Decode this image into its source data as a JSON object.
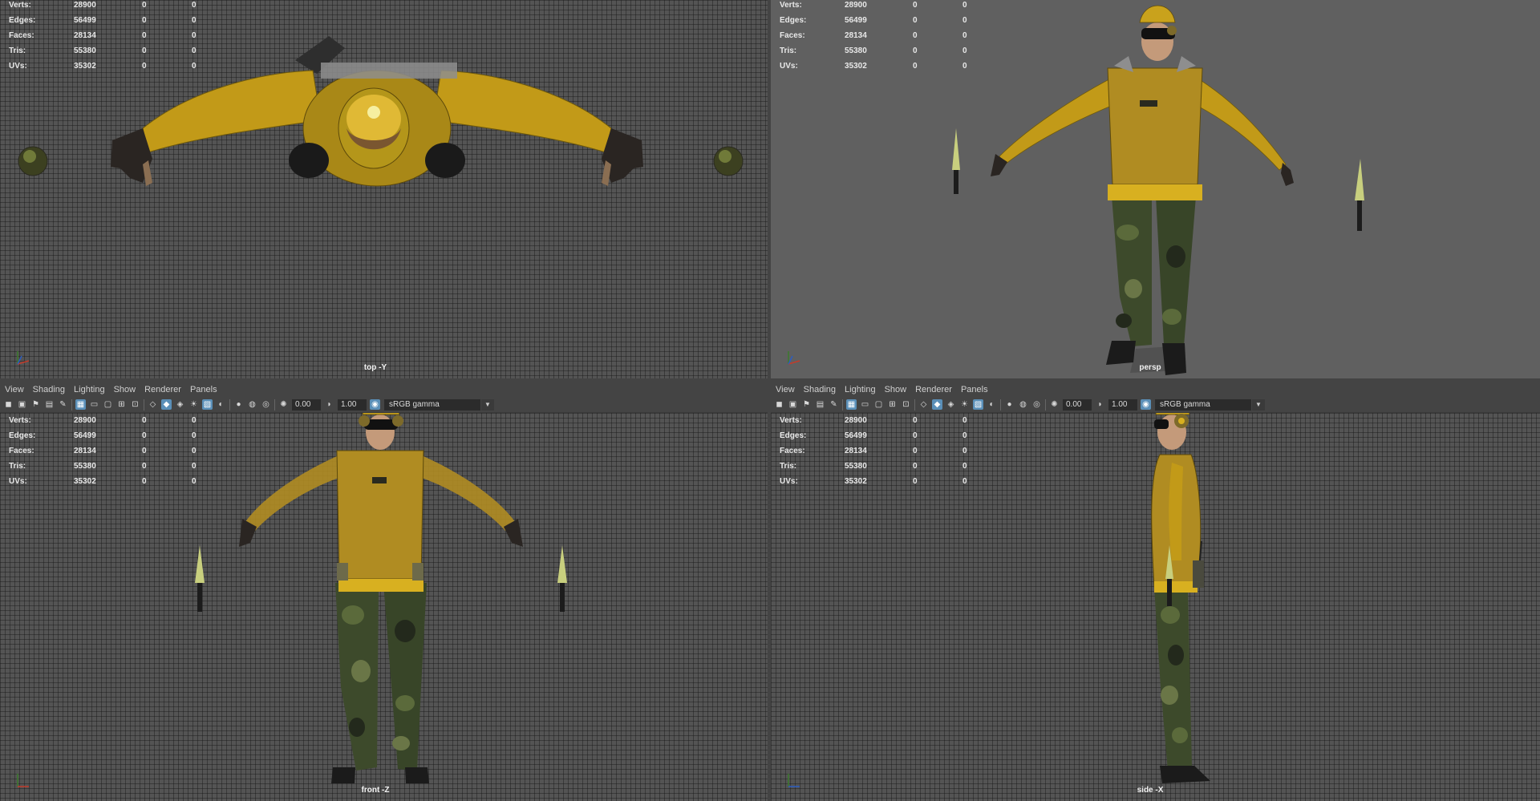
{
  "stats": [
    {
      "label": "Verts:",
      "v1": "28900",
      "v2": "0",
      "v3": "0"
    },
    {
      "label": "Edges:",
      "v1": "56499",
      "v2": "0",
      "v3": "0"
    },
    {
      "label": "Faces:",
      "v1": "28134",
      "v2": "0",
      "v3": "0"
    },
    {
      "label": "Tris:",
      "v1": "55380",
      "v2": "0",
      "v3": "0"
    },
    {
      "label": "UVs:",
      "v1": "35302",
      "v2": "0",
      "v3": "0"
    }
  ],
  "menu": [
    "View",
    "Shading",
    "Lighting",
    "Show",
    "Renderer",
    "Panels"
  ],
  "toolbar": {
    "exposure": "0.00",
    "gamma": "1.00",
    "color_space": "sRGB gamma"
  },
  "viewports": {
    "top": {
      "camera": "top -Y"
    },
    "persp": {
      "camera": "persp"
    },
    "front": {
      "camera": "front -Z"
    },
    "side": {
      "camera": "side -X"
    }
  },
  "colors": {
    "viewport_bg": "#545454",
    "jacket_yellow": "#c9a21c",
    "vest_yellow": "#b8962a",
    "camo_dark": "#3a4a2e",
    "active_icon": "#5a8fb8"
  },
  "icons": [
    "camera-icon",
    "camera-attr-icon",
    "bookmark-icon",
    "image-plane-icon",
    "grid-icon",
    "film-gate-icon",
    "wireframe-icon",
    "smooth-shade-icon",
    "textured-icon",
    "lighting-icon",
    "shadows-icon",
    "xray-icon",
    "isolate-icon",
    "exposure-icon",
    "gamma-icon",
    "color-space-icon"
  ]
}
